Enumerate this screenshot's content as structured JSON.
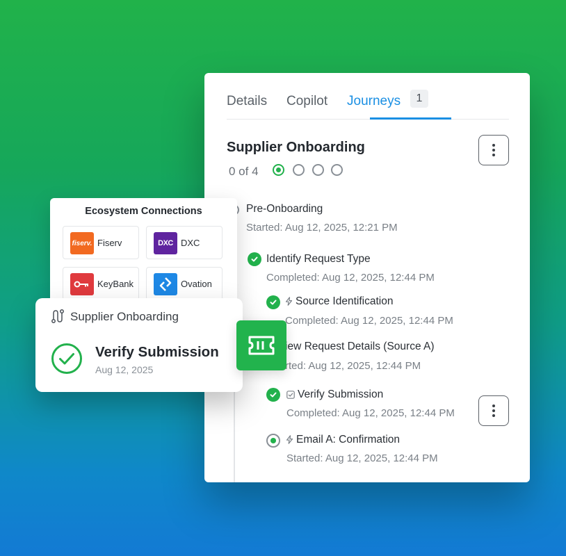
{
  "tabs": [
    {
      "label": "Details"
    },
    {
      "label": "Copilot"
    },
    {
      "label": "Journeys",
      "badge": "1",
      "active": true
    }
  ],
  "journey": {
    "title": "Supplier Onboarding",
    "progress_text": "0 of 4",
    "steps_total": 4,
    "active_step": 1,
    "items": [
      {
        "title": "Pre-Onboarding",
        "sub": "Started: Aug 12, 2025, 12:21 PM",
        "status": "started"
      },
      {
        "title": "Identify Request Type",
        "sub": "Completed: Aug 12, 2025, 12:44 PM",
        "status": "completed"
      },
      {
        "title": "Source Identification",
        "sub": "Completed: Aug 12, 2025, 12:44 PM",
        "status": "completed",
        "icon": "lightning-icon"
      },
      {
        "title": "View Request Details (Source A)",
        "visible_title": "iew Request Details (Source A)",
        "sub": "rted: Aug 12, 2025, 12:44 PM",
        "status": "started"
      },
      {
        "title": "Verify Submission",
        "sub": "Completed: Aug 12, 2025, 12:44 PM",
        "status": "completed",
        "icon": "checkbox-icon"
      },
      {
        "title": "Email A: Confirmation",
        "sub": "Started: Aug 12, 2025, 12:44 PM",
        "status": "in-progress",
        "icon": "lightning-icon"
      }
    ]
  },
  "ecosystem": {
    "title": "Ecosystem Connections",
    "partners": [
      {
        "name": "Fiserv",
        "logo_text": "fiserv.",
        "color": "#f26a21"
      },
      {
        "name": "DXC",
        "logo_text": "DXC",
        "color": "#5f249f"
      },
      {
        "name": "KeyBank",
        "logo_text": "key",
        "color": "#e03a3e"
      },
      {
        "name": "Ovation",
        "logo_text": "ovation",
        "color": "#1e88e5"
      }
    ]
  },
  "verify_card": {
    "header": "Supplier Onboarding",
    "title": "Verify Submission",
    "date": "Aug 12, 2025"
  },
  "colors": {
    "accent_blue": "#1a8fe3",
    "success_green": "#22b14c"
  }
}
